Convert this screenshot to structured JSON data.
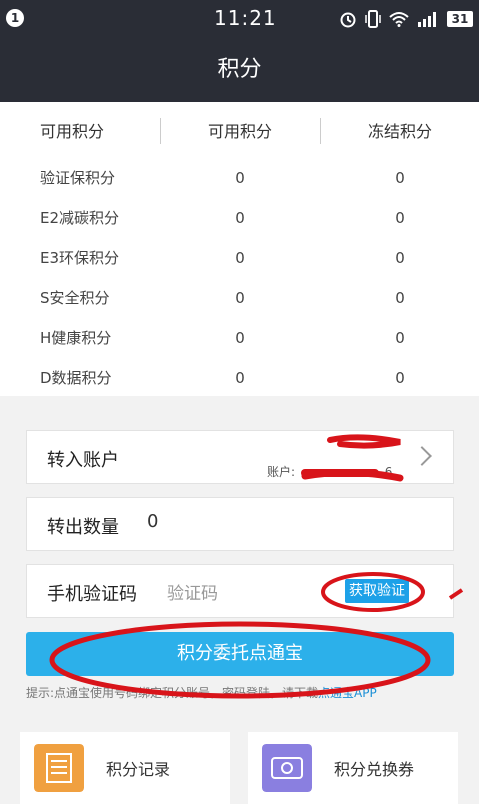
{
  "status_bar": {
    "notification_count": "1",
    "time": "11:21",
    "battery": "31",
    "icons": [
      "alarm-icon",
      "vibrate-icon",
      "wifi-icon",
      "signal-icon",
      "battery-icon"
    ]
  },
  "header": {
    "title": "积分"
  },
  "points_table": {
    "headers": [
      "可用积分",
      "可用积分",
      "冻结积分"
    ],
    "rows": [
      {
        "name": "验证保积分",
        "available": "0",
        "frozen": "0"
      },
      {
        "name": "E2减碳积分",
        "available": "0",
        "frozen": "0"
      },
      {
        "name": "E3环保积分",
        "available": "0",
        "frozen": "0"
      },
      {
        "name": "S安全积分",
        "available": "0",
        "frozen": "0"
      },
      {
        "name": "H健康积分",
        "available": "0",
        "frozen": "0"
      },
      {
        "name": "D数据积分",
        "available": "0",
        "frozen": "0"
      }
    ]
  },
  "form": {
    "transfer_account_label": "转入账户",
    "account_prefix": "账户:",
    "account_suffix": "6",
    "quantity_label": "转出数量",
    "quantity_value": "0",
    "phone_code_label": "手机验证码",
    "code_placeholder": "验证码",
    "get_code_button": "获取验证",
    "submit_button": "积分委托点通宝",
    "hint_text": "提示:点通宝使用号码绑定积分账号，密码登陆，请下载",
    "hint_link": "点通宝APP"
  },
  "bottom_nav": [
    {
      "label": "积分记录",
      "icon": "ledger-icon"
    },
    {
      "label": "积分兑换券",
      "icon": "coupon-icon"
    }
  ],
  "colors": {
    "header_bg": "#2a2d36",
    "accent_blue": "#2cb0ea",
    "annotation_red": "#d8141a"
  }
}
